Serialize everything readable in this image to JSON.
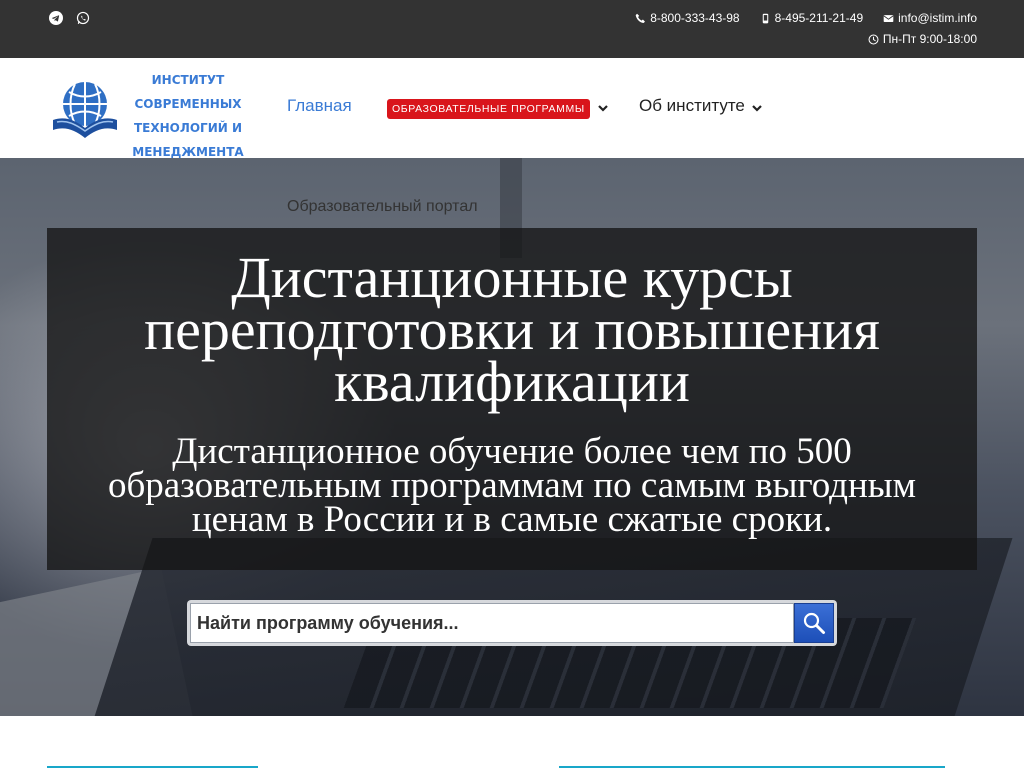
{
  "topbar": {
    "social": [
      {
        "icon": "telegram-icon"
      },
      {
        "icon": "whatsapp-icon"
      }
    ],
    "phone1": "8-800-333-43-98",
    "phone2": "8-495-211-21-49",
    "email": "info@istim.info",
    "hours": "Пн-Пт 9:00-18:00"
  },
  "nav": {
    "logo_line1": "ИНСТИТУТ",
    "logo_line2": "СОВРЕМЕННЫХ",
    "logo_line3": "ТЕХНОЛОГИЙ И",
    "logo_line4": "МЕНЕДЖМЕНТА",
    "home": "Главная",
    "programs": "ОБРАЗОВАТЕЛЬНЫЕ ПРОГРАММЫ",
    "about": "Об институте"
  },
  "hero": {
    "portal": "Образовательный портал",
    "title_line1": "Дистанционные курсы",
    "title_line2": "переподготовки и повышения",
    "title_line3": "квалификации",
    "subtitle_line1": "Дистанционное обучение более чем по 500",
    "subtitle_line2": "образовательным программам по самым выгодным",
    "subtitle_line3": "ценам в России и в самые сжатые сроки."
  },
  "search": {
    "placeholder": "Найти программу обучения..."
  },
  "colors": {
    "accent": "#3a7bd5",
    "programs_badge": "#d9151b",
    "topbar": "#333333",
    "card_border": "#19a7c9"
  }
}
